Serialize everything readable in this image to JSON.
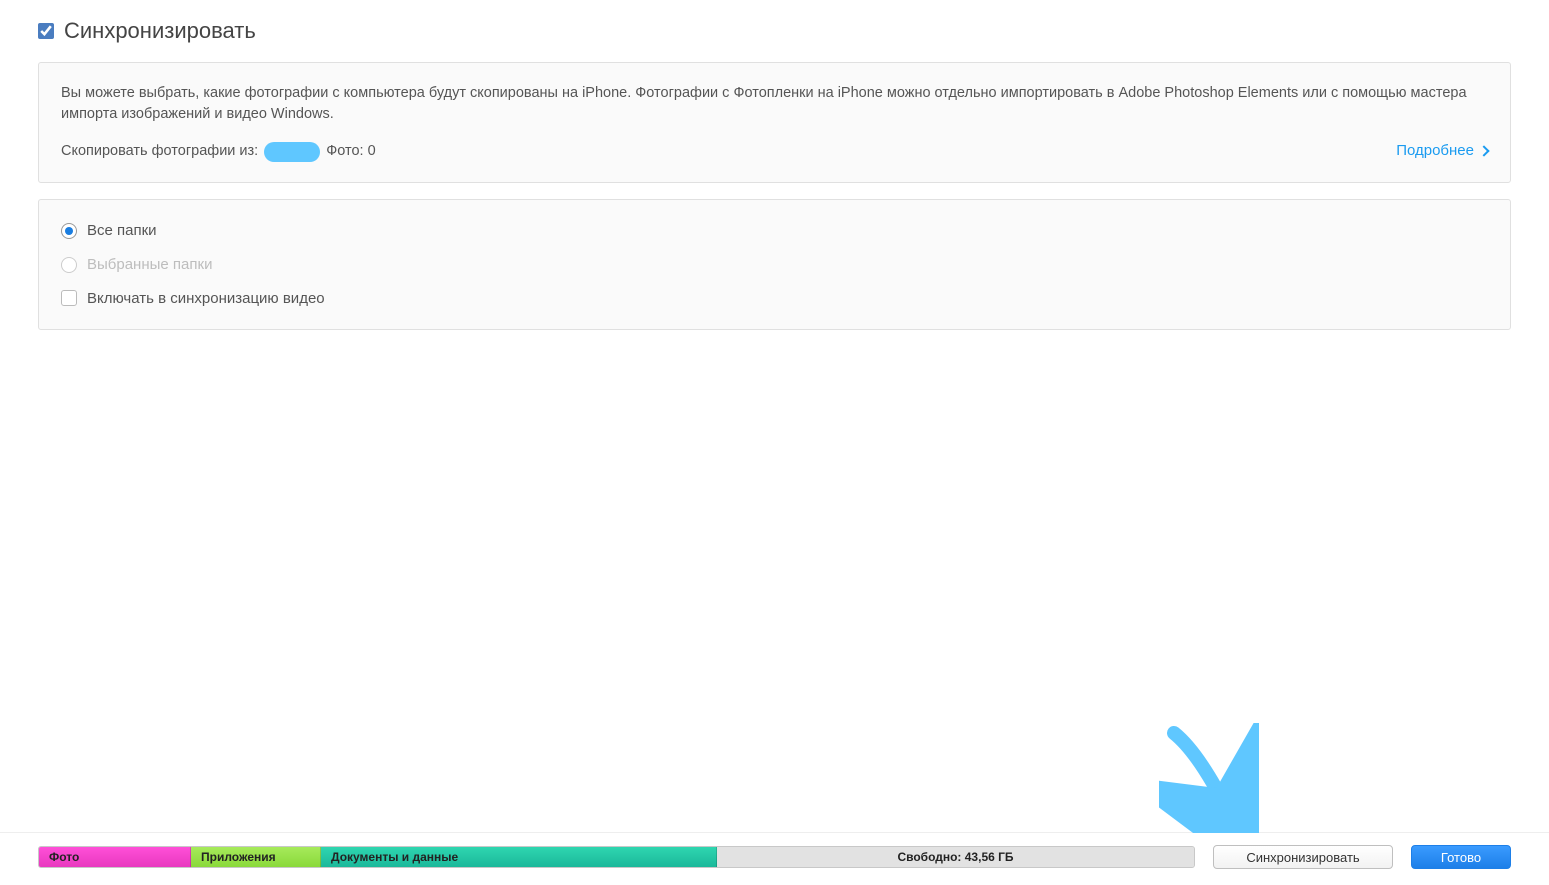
{
  "header": {
    "sync_checkbox_checked": true,
    "title": "Синхронизировать"
  },
  "info_panel": {
    "description": "Вы можете выбрать, какие фотографии с компьютера будут скопированы на iPhone. Фотографии с Фотопленки на iPhone можно отдельно импортировать в Adobe Photoshop Elements или с помощью мастера импорта изображений и видео Windows.",
    "copy_from_label": "Скопировать фотографии из:",
    "photo_count_label": "Фото: 0",
    "learn_more": "Подробнее"
  },
  "options": {
    "all_folders": "Все папки",
    "selected_folders": "Выбранные папки",
    "include_videos": "Включать в синхронизацию видео"
  },
  "storage": {
    "segments": {
      "photo": "Фото",
      "apps": "Приложения",
      "docs": "Документы и данные",
      "free": "Свободно: 43,56 ГБ"
    }
  },
  "footer": {
    "sync_button": "Синхронизировать",
    "done_button": "Готово"
  },
  "annotation": {
    "arrow_color": "#5fc7ff"
  }
}
